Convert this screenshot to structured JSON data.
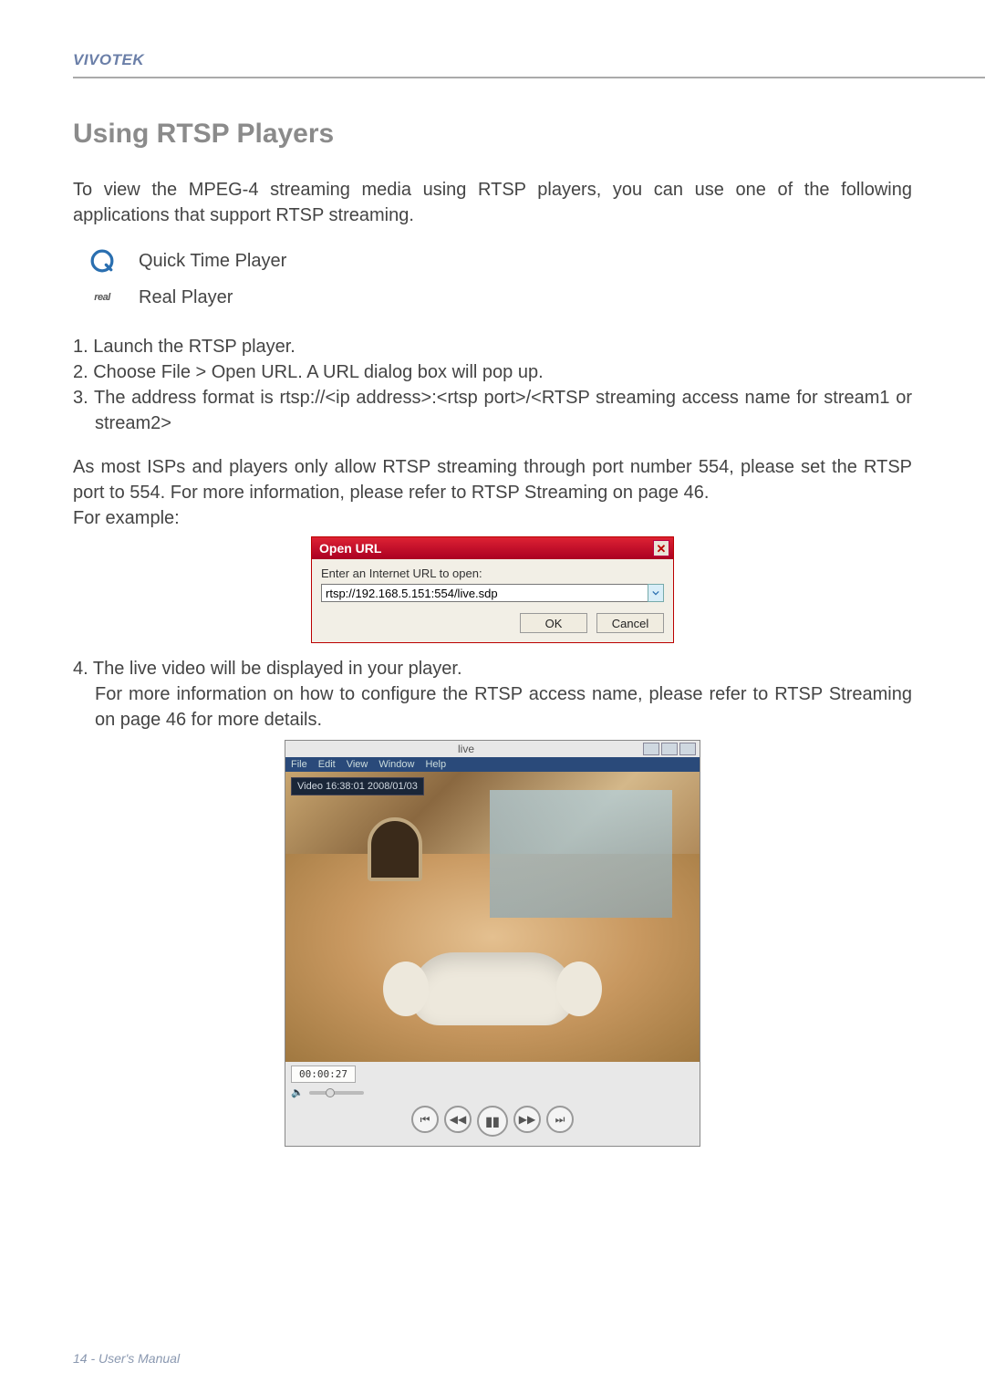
{
  "brand": "VIVOTEK",
  "section_title": "Using RTSP Players",
  "intro": "To view the MPEG-4 streaming media using RTSP players, you can use one of the following applications that support RTSP streaming.",
  "apps": {
    "quicktime": "Quick Time Player",
    "realplayer": "Real Player"
  },
  "steps": {
    "s1": "1. Launch the RTSP player.",
    "s2": "2. Choose File > Open URL. A URL dialog box will pop up.",
    "s3": "3. The address format is rtsp://<ip address>:<rtsp port>/<RTSP streaming access name for stream1 or stream2>",
    "s4_main": "4. The live video will be displayed in your player.",
    "s4_sub": "For more information on how to configure the RTSP access name, please refer to RTSP Streaming on page 46 for more details."
  },
  "isp_note": "As most ISPs and players only allow RTSP streaming through port number 554, please set the RTSP port to 554. For more information, please refer to RTSP Streaming on page 46.",
  "for_example": "For example:",
  "dialog": {
    "title": "Open URL",
    "label": "Enter an Internet URL to open:",
    "url_prefix": "rtsp://192.168.5.151:554/",
    "url_selected": "live.sdp",
    "ok": "OK",
    "cancel": "Cancel"
  },
  "player": {
    "title": "live",
    "menu": [
      "File",
      "Edit",
      "View",
      "Window",
      "Help"
    ],
    "overlay": "Video 16:38:01 2008/01/03",
    "timecode": "00:00:27"
  },
  "footer": "14 - User's Manual"
}
